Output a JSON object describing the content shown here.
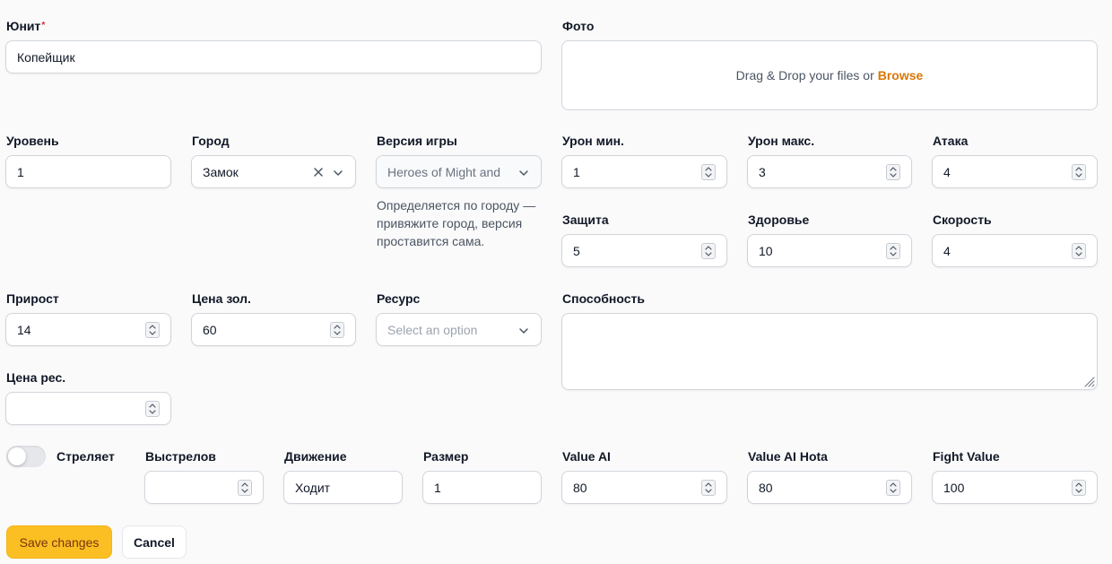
{
  "unit": {
    "label": "Юнит",
    "required": "*",
    "value": "Копейщик"
  },
  "photo": {
    "label": "Фото",
    "drop_text": "Drag & Drop your files or",
    "browse": "Browse"
  },
  "level": {
    "label": "Уровень",
    "value": "1"
  },
  "city": {
    "label": "Город",
    "value": "Замок"
  },
  "game_version": {
    "label": "Версия игры",
    "value": "Heroes of Might and",
    "hint": "Определяется по городу — привяжите город, версия проставится сама."
  },
  "damage_min": {
    "label": "Урон мин.",
    "value": "1"
  },
  "damage_max": {
    "label": "Урон макс.",
    "value": "3"
  },
  "attack": {
    "label": "Атака",
    "value": "4"
  },
  "defense": {
    "label": "Защита",
    "value": "5"
  },
  "health": {
    "label": "Здоровье",
    "value": "10"
  },
  "speed": {
    "label": "Скорость",
    "value": "4"
  },
  "growth": {
    "label": "Прирост",
    "value": "14"
  },
  "gold_price": {
    "label": "Цена зол.",
    "value": "60"
  },
  "resource": {
    "label": "Ресурс",
    "placeholder": "Select an option"
  },
  "ability": {
    "label": "Способность",
    "value": ""
  },
  "resource_price": {
    "label": "Цена рес.",
    "value": ""
  },
  "shooter": {
    "label": "Стреляет",
    "on": false
  },
  "shots": {
    "label": "Выстрелов",
    "value": ""
  },
  "movement": {
    "label": "Движение",
    "value": "Ходит"
  },
  "size": {
    "label": "Размер",
    "value": "1"
  },
  "value_ai": {
    "label": "Value AI",
    "value": "80"
  },
  "value_ai_hota": {
    "label": "Value AI Hota",
    "value": "80"
  },
  "fight_value": {
    "label": "Fight Value",
    "value": "100"
  },
  "actions": {
    "save": "Save changes",
    "cancel": "Cancel"
  },
  "colors": {
    "accent": "#fbbf24",
    "link": "#d97706",
    "required": "#dc2626"
  },
  "icons": {
    "spinner": "up-down-chevron-icon",
    "dropdown": "chevron-down-icon",
    "clear": "x-icon",
    "resize": "resize-handle-icon"
  }
}
